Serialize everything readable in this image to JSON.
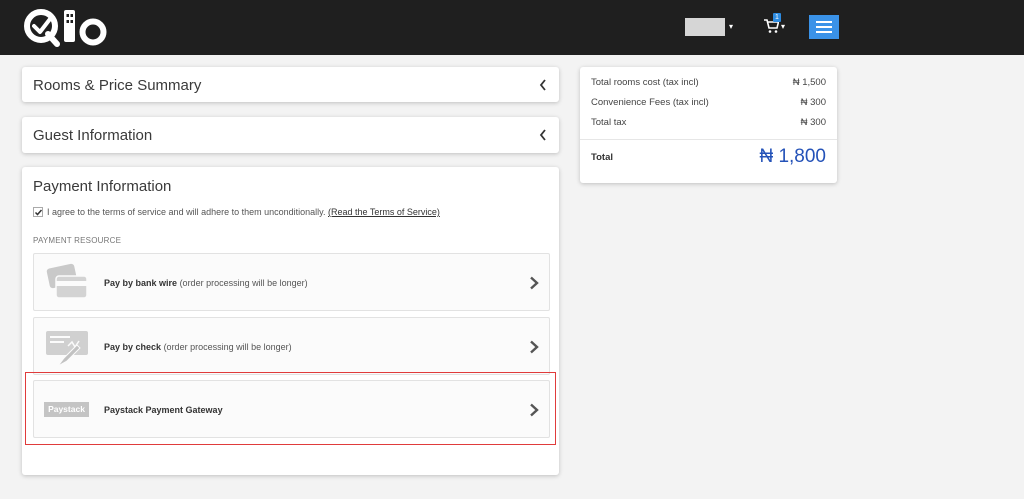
{
  "header": {
    "logo_text": "Qlo",
    "cart_count": "1"
  },
  "sections": {
    "rooms_price_summary": "Rooms & Price Summary",
    "guest_information": "Guest Information",
    "payment_information": "Payment Information"
  },
  "payment": {
    "terms_checked": true,
    "terms_text": "I agree to the terms of service and will adhere to them unconditionally.",
    "terms_link": "(Read the Terms of Service)",
    "resource_label": "PAYMENT RESOURCE",
    "options": [
      {
        "icon": "bank-card-icon",
        "bold": "Pay by bank wire",
        "note": "(order processing will be longer)"
      },
      {
        "icon": "check-icon",
        "bold": "Pay by check",
        "note": "(order processing will be longer)"
      },
      {
        "icon": "paystack-logo",
        "logo_text": "Paystack",
        "bold": "Paystack Payment Gateway",
        "note": ""
      }
    ]
  },
  "summary": {
    "rows": [
      {
        "label": "Total rooms cost (tax incl)",
        "amount": "₦ 1,500"
      },
      {
        "label": "Convenience Fees (tax incl)",
        "amount": "₦ 300"
      },
      {
        "label": "Total tax",
        "amount": "₦ 300"
      }
    ],
    "total_label": "Total",
    "total_amount": "₦ 1,800"
  },
  "colors": {
    "topbar": "#1f1f1f",
    "accent_blue": "#3a92e8",
    "total_blue": "#2452b8",
    "highlight_red": "#e03b3b"
  }
}
